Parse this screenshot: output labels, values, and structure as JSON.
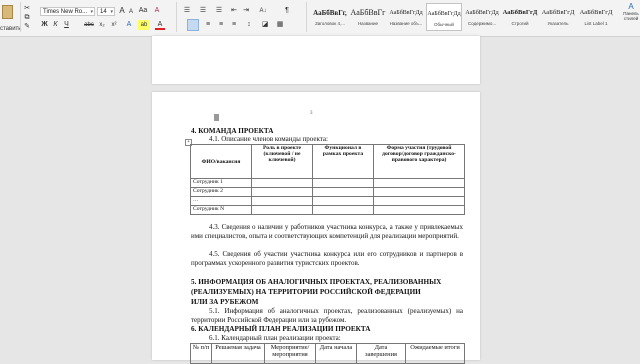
{
  "ribbon": {
    "paste_label": "ставить",
    "font_name": "Times New Ro...",
    "font_size": "14",
    "grow_font": "A",
    "shrink_font": "A",
    "aa": "Aa",
    "clear_format": "A",
    "bullets": "☰",
    "numbering": "☰",
    "multilevel": "☰",
    "decrease_indent": "⇤",
    "increase_indent": "⇥",
    "sort": "A↓",
    "pilcrow": "¶",
    "bold": "Ж",
    "italic": "К",
    "underline": "Ч",
    "strike": "abc",
    "subscript": "x₂",
    "superscript": "x²",
    "text_effects": "A",
    "highlight": "ab",
    "font_color": "A",
    "styles": [
      {
        "sample": "АаБбВвГг,",
        "name": "Заголовок 4,..."
      },
      {
        "sample": "АаБбВвГг",
        "name": "Название"
      },
      {
        "sample": "АаБбВвГгДд",
        "name": "Название объ..."
      },
      {
        "sample": "АаБбВвГгДд",
        "name": "Обычный"
      },
      {
        "sample": "АаБбВвГгДд",
        "name": "Содержимо..."
      },
      {
        "sample": "АаБбВвГгД",
        "name": "Строгий"
      },
      {
        "sample": "АаБбВвГгД",
        "name": "Указатель"
      },
      {
        "sample": "АаБбВвГгД",
        "name": "List Label 1"
      }
    ],
    "right_panel_label": "Панель\nстилей"
  },
  "document": {
    "page_number": "3",
    "section4_title": "4.  КОМАНДА ПРОЕКТА",
    "s41": "4.1. Описание членов команды проекта:",
    "team_headers": [
      "ФИО/вакансия",
      "Роль в проекте (ключевой / не ключевой)",
      "Функционал в рамках проекта",
      "Форма участия (трудовой договор/договор гражданско-правового характера)"
    ],
    "team_rows": [
      "Сотрудник 1",
      "Сотрудник 2",
      "…",
      "Сотрудник N"
    ],
    "p43": "4.3. Сведения о наличии у работников участника конкурса, а также у привлекаемых ими специалистов, опыта и соответствующих компетенций для реализации мероприятий.",
    "p45": "4.5. Сведения об участии участника конкурса или его сотрудников и партнеров в программах ускоренного развития туристских проектов.",
    "section5_line1": "5.  ИНФОРМАЦИЯ ОБ АНАЛОГИЧНЫХ ПРОЕКТАХ, РЕАЛИЗОВАННЫХ",
    "section5_line2": "(РЕАЛИЗУЕМЫХ) НА ТЕРРИТОРИИ РОССИЙСКОЙ ФЕДЕРАЦИИ",
    "section5_line3": "ИЛИ ЗА РУБЕЖОМ",
    "p51": "5.1. Информация об аналогичных проектах, реализованных (реализуемых) на территории Российской Федерации или за рубежом.",
    "section6_title": "6.  КАЛЕНДАРНЫЙ ПЛАН РЕАЛИЗАЦИИ ПРОЕКТА",
    "s61": "6.1. Календарный план реализации проекта:",
    "cal_headers": [
      "№ п/п",
      "Решаемая задача",
      "Мероприятие/ мероприятия",
      "Дата начала",
      "Дата завершения",
      "Ожидаемые итоги"
    ]
  }
}
